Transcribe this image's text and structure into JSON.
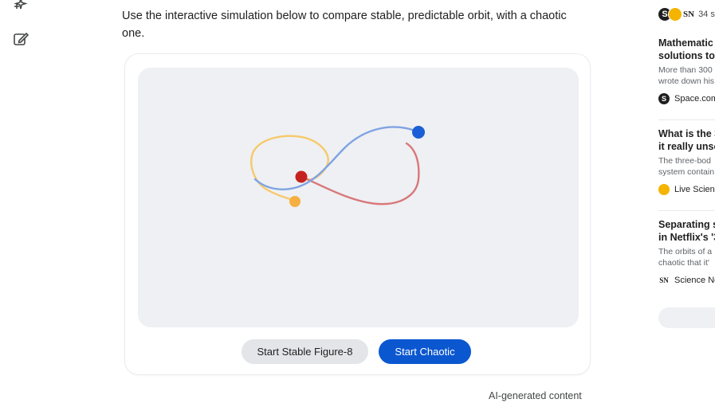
{
  "intro": {
    "line1": "Use the interactive simulation below to compare stable, predictable orbit, with a chaotic",
    "line2": "one."
  },
  "buttons": {
    "stable": "Start Stable Figure-8",
    "chaotic": "Start Chaotic"
  },
  "footer": {
    "note": "AI-generated content"
  },
  "simulation": {
    "bodies": [
      {
        "name": "body-blue",
        "color": "#1a5fd6"
      },
      {
        "name": "body-red",
        "color": "#c5221f"
      },
      {
        "name": "body-orange",
        "color": "#f5b041"
      }
    ],
    "trail_colors": {
      "blue": "#7fa3e3",
      "red": "#d9777a",
      "orange": "#f7c96a"
    }
  },
  "sources": {
    "logos": [
      "S",
      "flame",
      "SN"
    ],
    "count": "34 s"
  },
  "articles": [
    {
      "title1": "Mathematic",
      "title2": "solutions to",
      "snippet1": "More than 300",
      "snippet2": "wrote down his",
      "source": "Space.com",
      "icon": "S",
      "icon_color": "#1f1f1f"
    },
    {
      "title1": "What is the 3",
      "title2": "it really unso",
      "snippet1": "The three-bod",
      "snippet2": "system contain",
      "source": "Live Scienc",
      "icon": "flame",
      "icon_color": "#f4b400"
    },
    {
      "title1": "Separating s",
      "title2": "in Netflix's '3",
      "snippet1": "The orbits of a",
      "snippet2": "chaotic that it'",
      "source": "Science Ne",
      "icon": "SN",
      "icon_color": "#1f1f1f"
    }
  ]
}
